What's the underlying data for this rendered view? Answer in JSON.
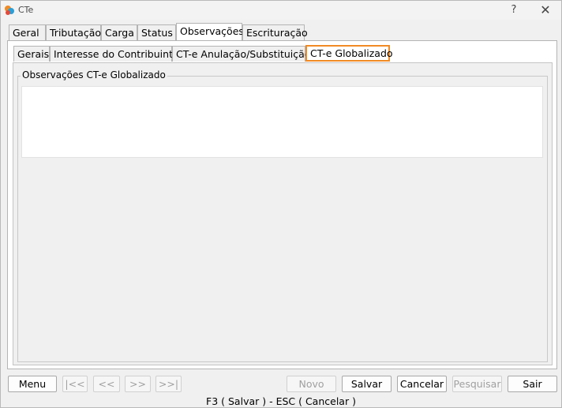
{
  "window": {
    "title": "CTe",
    "help": "?",
    "close": "✕"
  },
  "tabs": [
    {
      "label": "Geral"
    },
    {
      "label": "Tributação"
    },
    {
      "label": "Carga"
    },
    {
      "label": "Status"
    },
    {
      "label": "Observações",
      "active": true
    },
    {
      "label": "Escrituração"
    }
  ],
  "subtabs": [
    {
      "label": "Gerais"
    },
    {
      "label": "Interesse do Contribuinte"
    },
    {
      "label": "CT-e Anulação/Substituição"
    },
    {
      "label": "CT-e Globalizado",
      "active": true
    }
  ],
  "group": {
    "title": "Observações CT-e Globalizado",
    "value": ""
  },
  "buttons": {
    "menu": "Menu",
    "first": "|<<",
    "prev": "<<",
    "next": ">>",
    "last": ">>|",
    "novo": "Novo",
    "salvar": "Salvar",
    "cancelar": "Cancelar",
    "pesquisar": "Pesquisar",
    "sair": "Sair"
  },
  "status": "F3 ( Salvar )  -  ESC ( Cancelar )",
  "colors": {
    "accent_tab_border": "#f08a24"
  }
}
